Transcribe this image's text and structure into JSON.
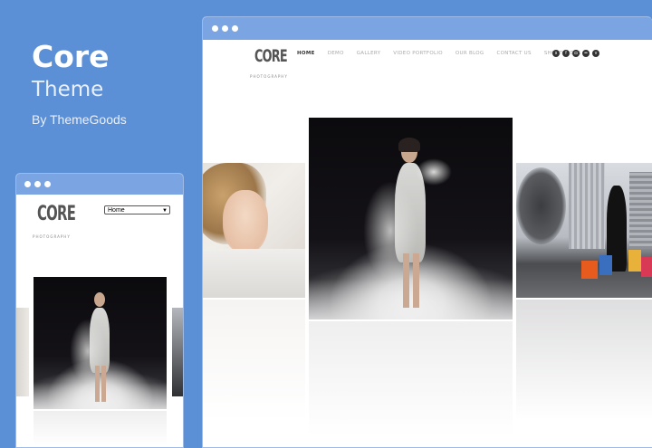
{
  "hero": {
    "title": "Core",
    "subtitle": "Theme",
    "byline": "By ThemeGoods"
  },
  "desktop": {
    "logo": {
      "main": "CORE",
      "tag": "PHOTOGRAPHY"
    },
    "nav": [
      "HOME",
      "DEMO",
      "GALLERY",
      "VIDEO PORTFOLIO",
      "OUR BLOG",
      "CONTACT US",
      "SHORTCODES"
    ],
    "active_nav": "HOME",
    "social_icons": [
      "skype-icon",
      "facebook-icon",
      "instagram-icon",
      "flickr-icon",
      "vimeo-icon"
    ]
  },
  "mobile": {
    "logo": {
      "main": "CORE",
      "tag": "PHOTOGRAPHY"
    },
    "menu_select": "Home"
  },
  "colors": {
    "background": "#5b8fd6",
    "window_bar": "#7aa5e2"
  }
}
